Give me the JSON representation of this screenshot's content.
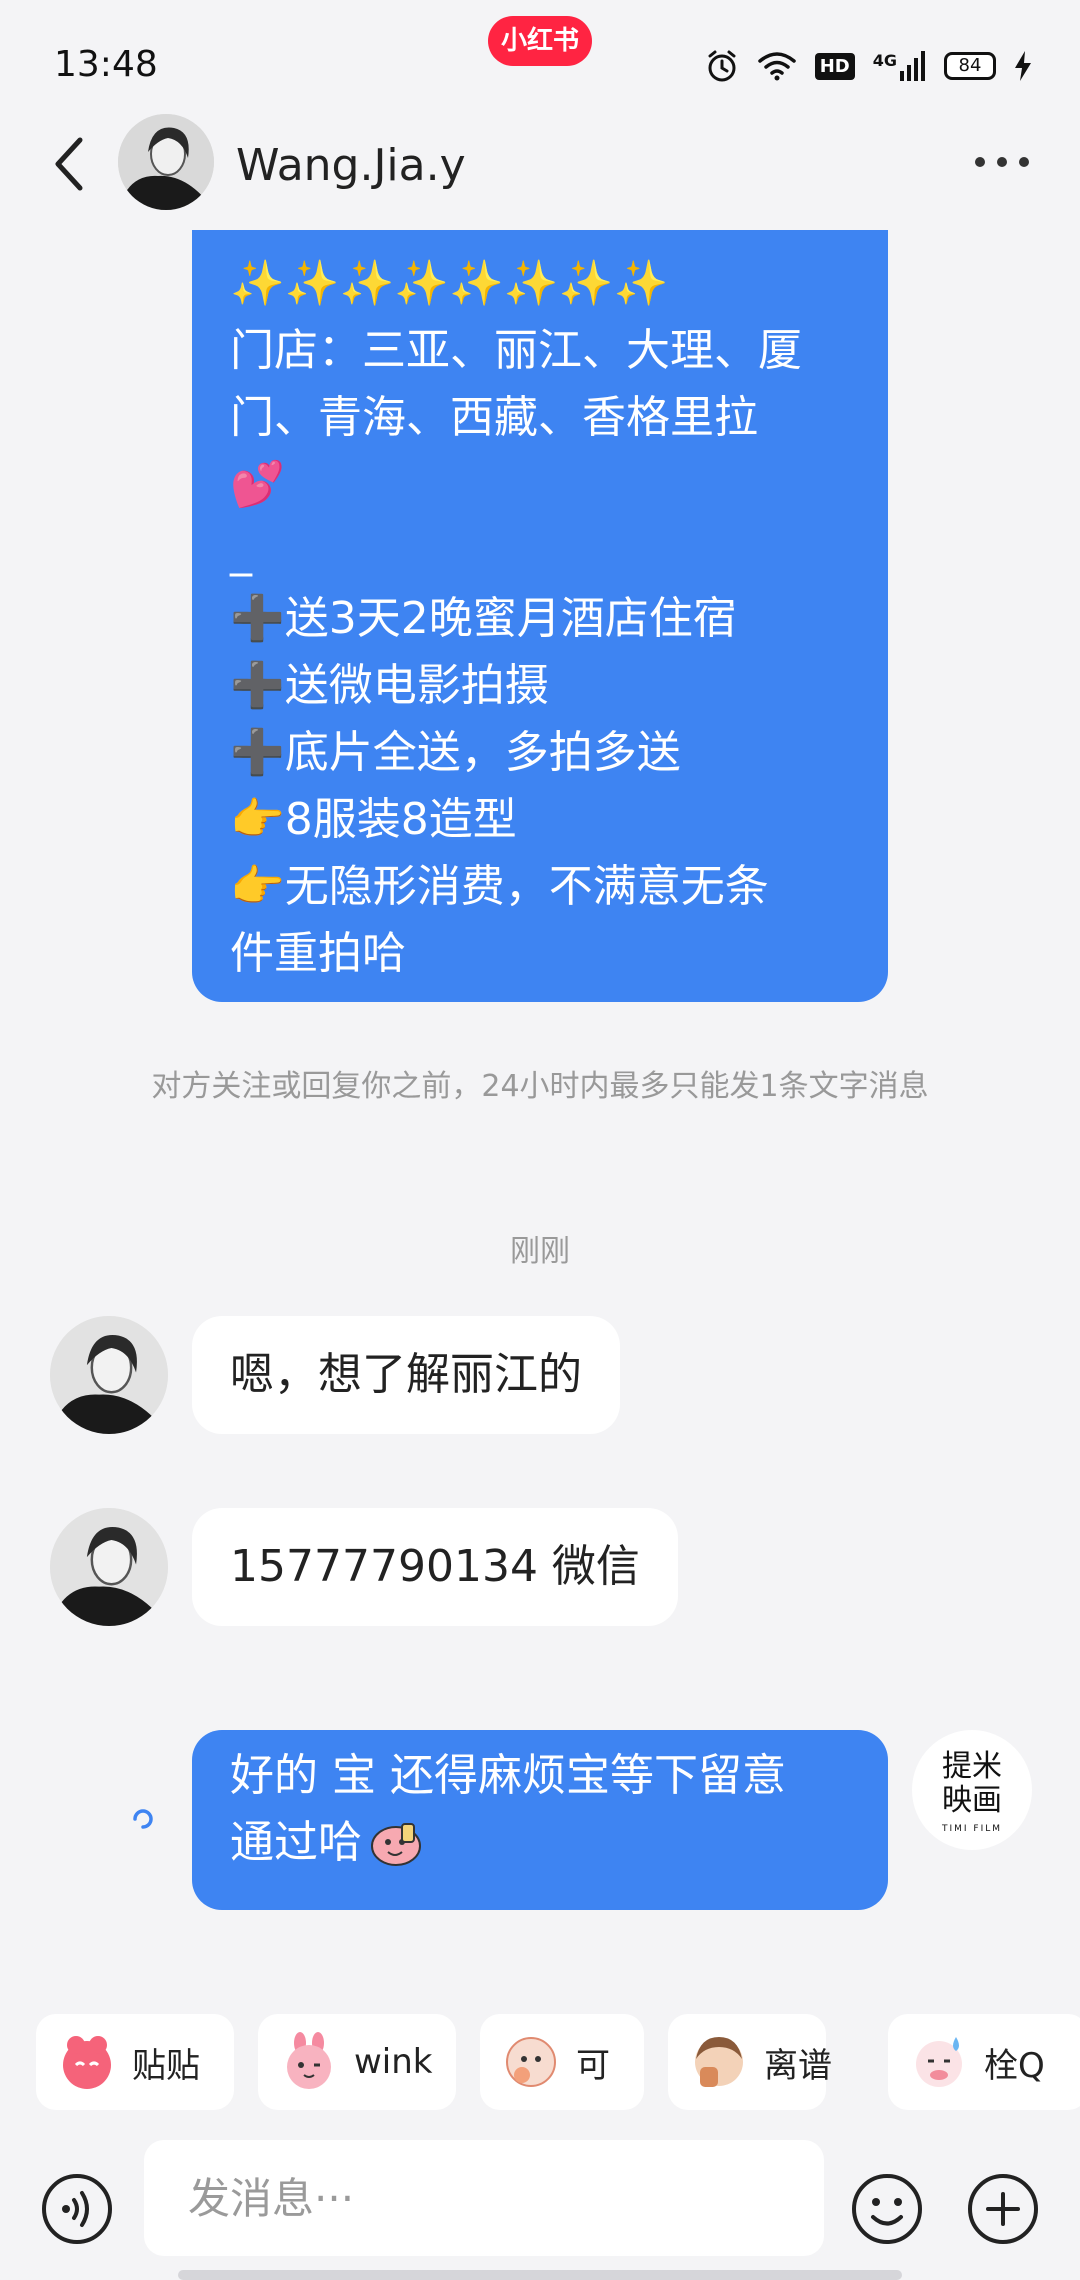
{
  "status_bar": {
    "time": "13:48",
    "app_badge": "小红书",
    "network_label": "4G",
    "hd_label": "HD",
    "battery": "84"
  },
  "header": {
    "contact_name": "Wang.Jia.y"
  },
  "messages": {
    "promo_lines": [
      "✨✨✨✨✨✨✨✨",
      "门店：三亚、丽江、大理、厦",
      "门、青海、西藏、香格里拉",
      "💕",
      "_",
      "➕送3天2晚蜜月酒店住宿",
      "➕送微电影拍摄",
      "➕底片全送，多拍多送",
      "👉8服装8造型",
      "👉无隐形消费，不满意无条",
      "件重拍哈"
    ],
    "notice": "对方关注或回复你之前，24小时内最多只能发1条文字消息",
    "timestamp": "刚刚",
    "incoming_1": "嗯，想了解丽江的",
    "incoming_2": "15777790134 微信",
    "reply_line_1": "好的 宝 还得麻烦宝等下留意",
    "reply_line_2": "通过哈",
    "my_avatar_text": "提米\n映画",
    "my_avatar_sub": "TIMI FILM"
  },
  "stickers": [
    {
      "label": "贴贴",
      "icon": "hug-sticker-icon",
      "color": "#f5637a"
    },
    {
      "label": "wink",
      "icon": "wink-sticker-icon",
      "color": "#f58aa0"
    },
    {
      "label": "可",
      "icon": "ok-sticker-icon",
      "color": "#f3a07a"
    },
    {
      "label": "离谱",
      "icon": "facepalm-sticker-icon",
      "color": "#d98a5a"
    },
    {
      "label": "栓Q",
      "icon": "sweat-sticker-icon",
      "color": "#f28c9b"
    }
  ],
  "input": {
    "placeholder": "发消息···"
  },
  "colors": {
    "accent": "#3e84f2",
    "brand": "#ff2442",
    "background": "#f4f4f6"
  }
}
